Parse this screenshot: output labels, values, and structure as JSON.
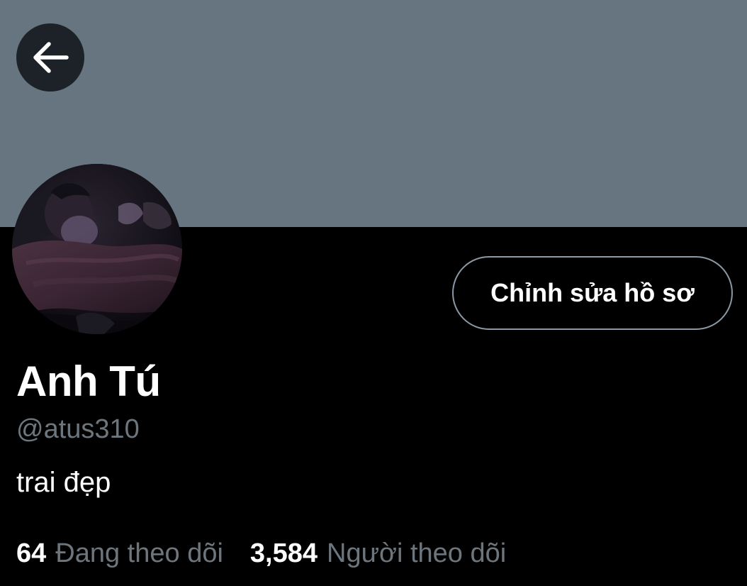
{
  "header": {
    "banner_color": "#66757f",
    "back_icon": "arrow-left-icon"
  },
  "profile": {
    "display_name": "Anh Tú",
    "username": "@atus310",
    "bio": "trai đẹp",
    "edit_profile_label": "Chỉnh sửa hồ sơ",
    "avatar": "profile-photo"
  },
  "stats": {
    "following_count": "64",
    "following_label": "Đang theo dõi",
    "followers_count": "3,584",
    "followers_label": "Người theo dõi"
  },
  "colors": {
    "background": "#000000",
    "primary_text": "#ffffff",
    "secondary_text": "#6e767d",
    "button_border": "#8b98a5"
  }
}
